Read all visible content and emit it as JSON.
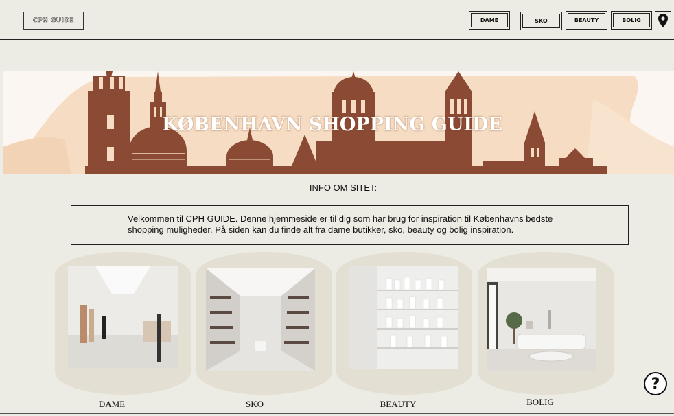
{
  "header": {
    "logo": "CPH GUIDE",
    "nav": [
      {
        "label": "DAME"
      },
      {
        "label": "SKO"
      },
      {
        "label": "BEAUTY"
      },
      {
        "label": "BOLIG"
      }
    ],
    "location_icon": "map-pin-icon"
  },
  "banner": {
    "title": "KØBENHAVN SHOPPING GUIDE"
  },
  "info": {
    "title": "INFO OM SITET:",
    "text": "Velkommen til CPH GUIDE. Denne hjemmeside er til dig som har brug for inspiration til Københavns bedste shopping muligheder. På siden kan du finde alt fra dame butikker, sko, beauty og bolig inspiration."
  },
  "categories": [
    {
      "label": "DAME",
      "image": "clothing-store-photo"
    },
    {
      "label": "SKO",
      "image": "shoe-store-photo"
    },
    {
      "label": "BEAUTY",
      "image": "beauty-shelves-photo"
    },
    {
      "label": "BOLIG",
      "image": "living-room-photo"
    }
  ],
  "help": {
    "label": "?",
    "icon": "help-icon"
  },
  "colors": {
    "background": "#ecebe4",
    "banner_peach": "#f6dcc2",
    "skyline_brown": "#8a4a34",
    "card_bg": "#e3dfd2"
  }
}
